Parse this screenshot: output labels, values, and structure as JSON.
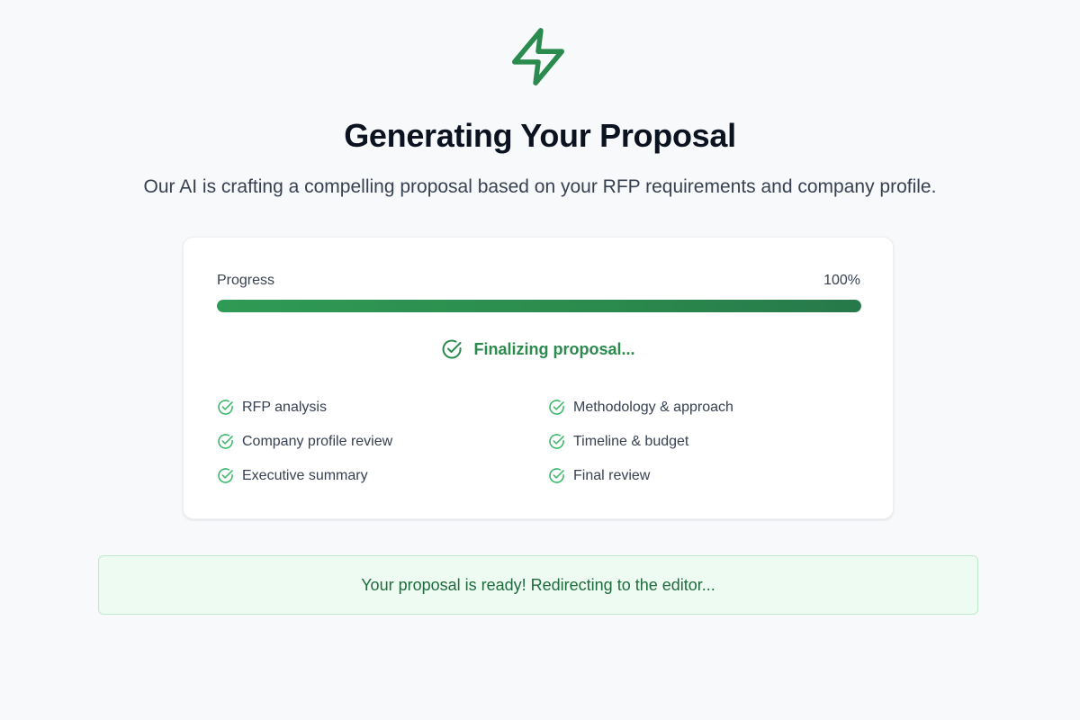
{
  "header": {
    "logo_icon": "lightning-bolt-icon",
    "title": "Generating Your Proposal",
    "subtitle": "Our AI is crafting a compelling proposal based on your RFP requirements and company profile."
  },
  "progress": {
    "label": "Progress",
    "percent_text": "100%",
    "value": 1.0,
    "status_icon": "check-circle-icon",
    "status_text": "Finalizing proposal..."
  },
  "steps": [
    {
      "label": "RFP analysis",
      "icon": "check-circle-icon",
      "done": true
    },
    {
      "label": "Methodology & approach",
      "icon": "check-circle-icon",
      "done": true
    },
    {
      "label": "Company profile review",
      "icon": "check-circle-icon",
      "done": true
    },
    {
      "label": "Timeline & budget",
      "icon": "check-circle-icon",
      "done": true
    },
    {
      "label": "Executive summary",
      "icon": "check-circle-icon",
      "done": true
    },
    {
      "label": "Final review",
      "icon": "check-circle-icon",
      "done": true
    }
  ],
  "banner": {
    "text": "Your proposal is ready! Redirecting to the editor..."
  },
  "colors": {
    "accent": "#2b8a4d",
    "step_check": "#3cb86a",
    "banner_bg": "#eefbf2",
    "banner_border": "#bde9cc",
    "banner_text": "#1f6b3c"
  }
}
